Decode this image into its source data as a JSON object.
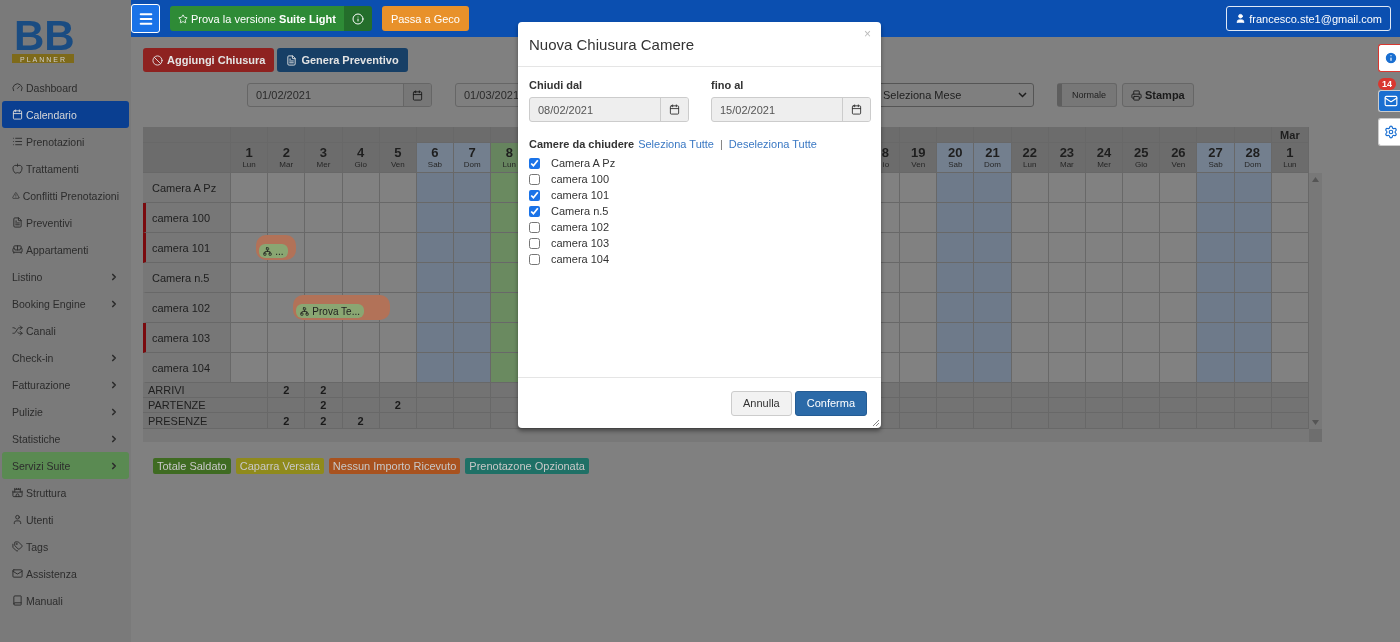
{
  "logo": {
    "letters": "BB",
    "tagline": "PLANNER"
  },
  "sidebar": {
    "items": [
      {
        "label": "Dashboard",
        "has_submenu": false,
        "selected": false,
        "highlighted": false
      },
      {
        "label": "Calendario",
        "has_submenu": false,
        "selected": true,
        "highlighted": false
      },
      {
        "label": "Prenotazioni",
        "has_submenu": false,
        "selected": false,
        "highlighted": false
      },
      {
        "label": "Trattamenti",
        "has_submenu": false,
        "selected": false,
        "highlighted": false
      },
      {
        "label": "Conflitti Prenotazioni",
        "has_submenu": false,
        "selected": false,
        "highlighted": false
      },
      {
        "label": "Preventivi",
        "has_submenu": false,
        "selected": false,
        "highlighted": false
      },
      {
        "label": "Appartamenti",
        "has_submenu": false,
        "selected": false,
        "highlighted": false
      },
      {
        "label": "Listino",
        "has_submenu": true,
        "selected": false,
        "highlighted": false
      },
      {
        "label": "Booking Engine",
        "has_submenu": true,
        "selected": false,
        "highlighted": false
      },
      {
        "label": "Canali",
        "has_submenu": false,
        "selected": false,
        "highlighted": false
      },
      {
        "label": "Check-in",
        "has_submenu": true,
        "selected": false,
        "highlighted": false
      },
      {
        "label": "Fatturazione",
        "has_submenu": true,
        "selected": false,
        "highlighted": false
      },
      {
        "label": "Pulizie",
        "has_submenu": true,
        "selected": false,
        "highlighted": false
      },
      {
        "label": "Statistiche",
        "has_submenu": true,
        "selected": false,
        "highlighted": false
      },
      {
        "label": "Servizi Suite",
        "has_submenu": true,
        "selected": false,
        "highlighted": true
      },
      {
        "label": "Struttura",
        "has_submenu": false,
        "selected": false,
        "highlighted": false
      },
      {
        "label": "Utenti",
        "has_submenu": false,
        "selected": false,
        "highlighted": false
      },
      {
        "label": "Tags",
        "has_submenu": false,
        "selected": false,
        "highlighted": false
      },
      {
        "label": "Assistenza",
        "has_submenu": false,
        "selected": false,
        "highlighted": false
      },
      {
        "label": "Manuali",
        "has_submenu": false,
        "selected": false,
        "highlighted": false
      }
    ]
  },
  "topbar": {
    "trial_button": "Prova la versione **Suite Light**",
    "switch_button": "Passa a Geco",
    "user": "francesco.ste1@gmail.com"
  },
  "toolbar": {
    "add_closure": "Aggiungi Chiusura",
    "quote": "Genera Preventivo"
  },
  "filters": {
    "date_from": "01/02/2021",
    "date_to": "01/03/2021",
    "month_select": "Seleziona Mese",
    "view_toggle": "Normale",
    "print": "Stampa"
  },
  "calendar": {
    "days": [
      {
        "day": "1",
        "weekday": "Lun",
        "kind": "weekday"
      },
      {
        "day": "2",
        "weekday": "Mar",
        "kind": "weekday"
      },
      {
        "day": "3",
        "weekday": "Mer",
        "kind": "weekday"
      },
      {
        "day": "4",
        "weekday": "Gio",
        "kind": "weekday"
      },
      {
        "day": "5",
        "weekday": "Ven",
        "kind": "weekday"
      },
      {
        "day": "6",
        "weekday": "Sab",
        "kind": "weekend"
      },
      {
        "day": "7",
        "weekday": "Dom",
        "kind": "weekend"
      },
      {
        "day": "8",
        "weekday": "Lun",
        "kind": "today"
      },
      {
        "day": "8",
        "weekday": "io",
        "kind": "partial"
      },
      {
        "day": "19",
        "weekday": "Ven",
        "kind": "weekday"
      },
      {
        "day": "20",
        "weekday": "Sab",
        "kind": "weekend"
      },
      {
        "day": "21",
        "weekday": "Dom",
        "kind": "weekend"
      },
      {
        "day": "22",
        "weekday": "Lun",
        "kind": "weekday"
      },
      {
        "day": "23",
        "weekday": "Mar",
        "kind": "weekday"
      },
      {
        "day": "24",
        "weekday": "Mer",
        "kind": "weekday"
      },
      {
        "day": "25",
        "weekday": "Gio",
        "kind": "weekday"
      },
      {
        "day": "26",
        "weekday": "Ven",
        "kind": "weekday"
      },
      {
        "day": "27",
        "weekday": "Sab",
        "kind": "weekend"
      },
      {
        "day": "28",
        "weekday": "Dom",
        "kind": "weekend"
      },
      {
        "day": "1",
        "weekday": "Lun",
        "kind": "weekday",
        "month": "Mar"
      }
    ],
    "rooms": [
      {
        "name": "Camera A Pz",
        "closed": false
      },
      {
        "name": "camera 100",
        "closed": true
      },
      {
        "name": "camera 101",
        "closed": true,
        "bookings": [
          {
            "label": "..."
          }
        ]
      },
      {
        "name": "Camera n.5",
        "closed": false
      },
      {
        "name": "camera 102",
        "closed": false,
        "bookings": [
          {
            "label": "Prova Te..."
          }
        ]
      },
      {
        "name": "camera 103",
        "closed": true
      },
      {
        "name": "camera 104",
        "closed": false
      }
    ],
    "summary": [
      {
        "label": "ARRIVI",
        "counts": [
          "2",
          "2"
        ]
      },
      {
        "label": "PARTENZE",
        "counts": [
          "2",
          "2"
        ]
      },
      {
        "label": "PRESENZE",
        "counts": [
          "2",
          "2",
          "2"
        ]
      }
    ]
  },
  "legend": [
    {
      "label": "Totale Saldato",
      "color": "#3f6b22"
    },
    {
      "label": "Caparra Versata",
      "color": "#8f8a1c"
    },
    {
      "label": "Nessun Importo Ricevuto",
      "color": "#a8521f"
    },
    {
      "label": "Prenotazone Opzionata",
      "color": "#1f7066"
    }
  ],
  "side_buttons": {
    "badge": "14"
  },
  "modal": {
    "title": "Nuova Chiusura Camere",
    "close": "×",
    "from_label": "Chiudi dal",
    "from_value": "08/02/2021",
    "to_label": "fino al",
    "to_value": "15/02/2021",
    "rooms_label": "Camere da chiudere",
    "select_all": "Seleziona Tutte",
    "separator": "|",
    "deselect_all": "Deseleziona Tutte",
    "rooms": [
      {
        "name": "Camera A Pz",
        "checked": true
      },
      {
        "name": "camera 100",
        "checked": false
      },
      {
        "name": "camera 101",
        "checked": true
      },
      {
        "name": "Camera n.5",
        "checked": true
      },
      {
        "name": "camera 102",
        "checked": false
      },
      {
        "name": "camera 103",
        "checked": false
      },
      {
        "name": "camera 104",
        "checked": false
      }
    ],
    "cancel": "Annulla",
    "confirm": "Conferma"
  }
}
